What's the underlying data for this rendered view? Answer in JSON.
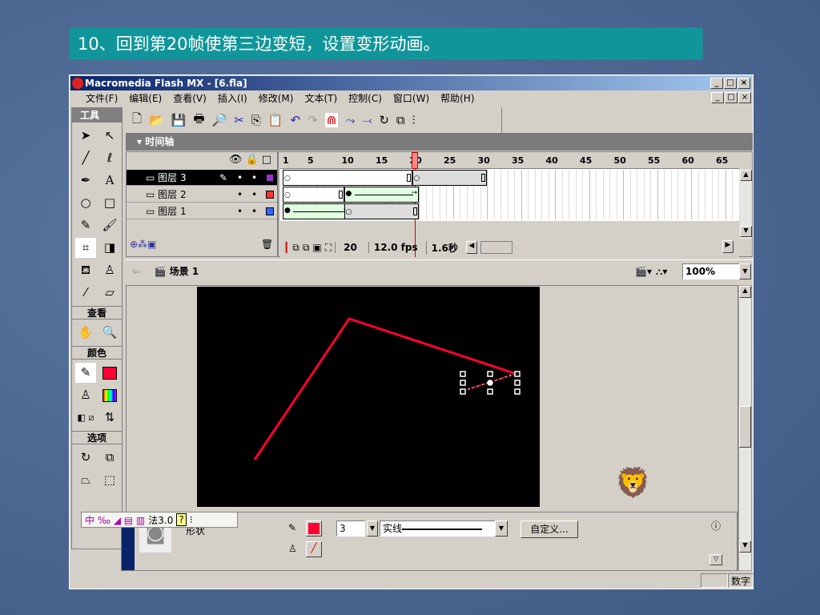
{
  "slide_title": "10、回到第20帧使第三边变短，设置变形动画。",
  "window": {
    "title": "Macromedia Flash MX - [6.fla]",
    "min": "_",
    "max": "□",
    "close": "×"
  },
  "menu": [
    "文件(F)",
    "编辑(E)",
    "查看(V)",
    "插入(I)",
    "修改(M)",
    "文本(T)",
    "控制(C)",
    "窗口(W)",
    "帮助(H)"
  ],
  "tools": {
    "title": "工具",
    "view": "查看",
    "colors": "颜色",
    "options": "选项",
    "stroke_color": "#ff0033"
  },
  "timeline": {
    "title": "时间轴",
    "ruler": [
      "1",
      "5",
      "10",
      "15",
      "20",
      "25",
      "30",
      "35",
      "40",
      "45",
      "50",
      "55",
      "60",
      "65"
    ],
    "current_frame": "20",
    "fps": "12.0 fps",
    "time": "1.6秒",
    "layers": [
      {
        "name": "图层 3",
        "color": "#9933cc",
        "selected": true,
        "spans": [
          {
            "from": 1,
            "to": 19,
            "type": "static"
          },
          {
            "from": 20,
            "to": 30,
            "type": "static-gray"
          }
        ]
      },
      {
        "name": "图层 2",
        "color": "#ff3333",
        "selected": false,
        "spans": [
          {
            "from": 1,
            "to": 9,
            "type": "static"
          },
          {
            "from": 10,
            "to": 20,
            "type": "tween"
          }
        ]
      },
      {
        "name": "图层 1",
        "color": "#3366ff",
        "selected": false,
        "spans": [
          {
            "from": 1,
            "to": 10,
            "type": "tween"
          },
          {
            "from": 10,
            "to": 20,
            "type": "static-gray"
          }
        ]
      }
    ]
  },
  "scene": {
    "name": "场景 1",
    "zoom": "100%"
  },
  "props": {
    "tool": "形状",
    "stroke_size": "3",
    "stroke_style": "实线",
    "custom": "自定义...",
    "ime": "法3.0",
    "stroke_color": "#ff0033"
  },
  "status": {
    "numlock": "数字"
  }
}
